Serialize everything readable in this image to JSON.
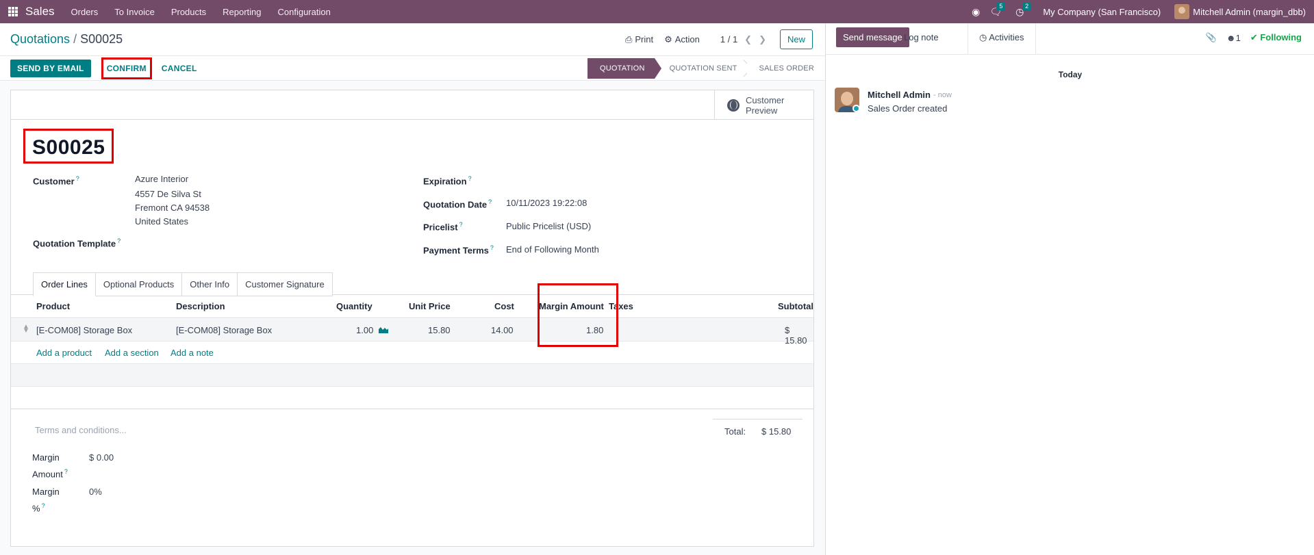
{
  "navbar": {
    "app": "Sales",
    "menu": [
      "Orders",
      "To Invoice",
      "Products",
      "Reporting",
      "Configuration"
    ],
    "messages_count": "5",
    "activities_count": "2",
    "company": "My Company (San Francisco)",
    "user": "Mitchell Admin (margin_dbb)"
  },
  "control_panel": {
    "breadcrumb_parent": "Quotations",
    "breadcrumb_sep": "/",
    "breadcrumb_current": "S00025",
    "print": "Print",
    "action": "Action",
    "pager": "1 / 1",
    "new": "New"
  },
  "buttons": {
    "send_by_email": "SEND BY EMAIL",
    "confirm": "CONFIRM",
    "cancel": "CANCEL"
  },
  "statusbar": [
    "QUOTATION",
    "QUOTATION SENT",
    "SALES ORDER"
  ],
  "smart_button": {
    "line1": "Customer",
    "line2": "Preview"
  },
  "form": {
    "name": "S00025",
    "customer_label": "Customer",
    "customer_name": "Azure Interior",
    "customer_addr1": "4557 De Silva St",
    "customer_addr2": "Fremont CA 94538",
    "customer_addr3": "United States",
    "template_label": "Quotation Template",
    "expiration_label": "Expiration",
    "quotation_date_label": "Quotation Date",
    "quotation_date": "10/11/2023 19:22:08",
    "pricelist_label": "Pricelist",
    "pricelist": "Public Pricelist (USD)",
    "payment_terms_label": "Payment Terms",
    "payment_terms": "End of Following Month",
    "help_mark": "?"
  },
  "tabs": [
    "Order Lines",
    "Optional Products",
    "Other Info",
    "Customer Signature"
  ],
  "table": {
    "headers": {
      "product": "Product",
      "description": "Description",
      "quantity": "Quantity",
      "unit_price": "Unit Price",
      "cost": "Cost",
      "margin_amount": "Margin Amount",
      "taxes": "Taxes",
      "subtotal": "Subtotal"
    },
    "rows": [
      {
        "product": "[E-COM08] Storage Box",
        "description": "[E-COM08] Storage Box",
        "quantity": "1.00",
        "unit_price": "15.80",
        "cost": "14.00",
        "margin_amount": "1.80",
        "taxes": "",
        "subtotal": "$ 15.80"
      }
    ],
    "add_product": "Add a product",
    "add_section": "Add a section",
    "add_note": "Add a note"
  },
  "footer": {
    "terms_placeholder": "Terms and conditions...",
    "margin_amount_label1": "Margin",
    "margin_amount_label2": "Amount",
    "margin_amount": "$ 0.00",
    "margin_pct_label1": "Margin",
    "margin_pct_label2": "%",
    "margin_pct": "0%",
    "total_label": "Total:",
    "total": "$ 15.80"
  },
  "chatter": {
    "send_message": "Send message",
    "log_note": "Log note",
    "activities": "Activities",
    "followers_count": "1",
    "following": "Following",
    "today": "Today",
    "author": "Mitchell Admin",
    "time": "- now",
    "body": "Sales Order created"
  },
  "colors": {
    "brand": "#714b67",
    "accent": "#017e84",
    "highlight": "#e00000",
    "following": "#16a34a"
  }
}
